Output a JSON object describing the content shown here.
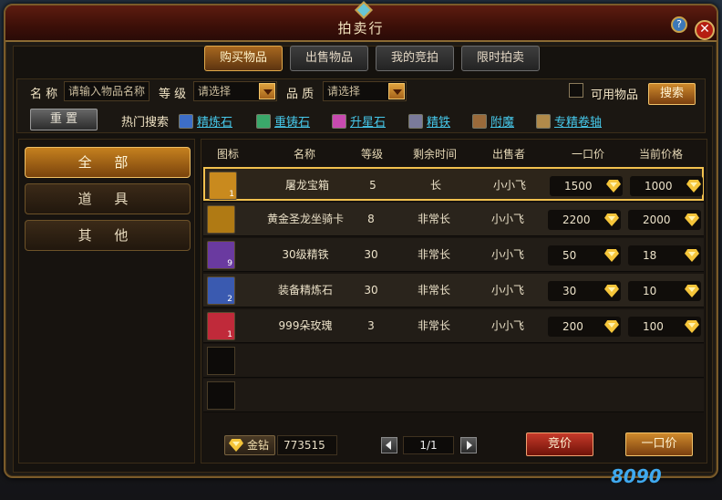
{
  "window": {
    "title": "拍卖行",
    "help_label": "?",
    "close_label": "✕"
  },
  "tabs": [
    {
      "label": "购买物品",
      "active": true
    },
    {
      "label": "出售物品",
      "active": false
    },
    {
      "label": "我的竞拍",
      "active": false
    },
    {
      "label": "限时拍卖",
      "active": false
    }
  ],
  "filters": {
    "name_label": "名 称",
    "name_placeholder": "请输入物品名称",
    "level_label": "等 级",
    "level_value": "请选择",
    "quality_label": "品 质",
    "quality_value": "请选择",
    "usable_label": "可用物品",
    "search_button": "搜索",
    "reset_button": "重 置",
    "hot_label": "热门搜索",
    "hot_items": [
      {
        "label": "精炼石",
        "color": "#3d6ec8"
      },
      {
        "label": "重铸石",
        "color": "#3aa86a"
      },
      {
        "label": "升星石",
        "color": "#c84ab0"
      },
      {
        "label": "精铁",
        "color": "#7a7a9a"
      },
      {
        "label": "附魔",
        "color": "#9a6a3a"
      },
      {
        "label": "专精卷轴",
        "color": "#b08a4a"
      }
    ]
  },
  "categories": [
    {
      "label": "全 部",
      "active": true
    },
    {
      "label": "道 具",
      "active": false
    },
    {
      "label": "其 他",
      "active": false
    }
  ],
  "table": {
    "headers": [
      "图标",
      "名称",
      "等级",
      "剩余时间",
      "出售者",
      "一口价",
      "当前价格"
    ],
    "rows": [
      {
        "icon": "treasure-chest-icon",
        "icon_color": "#c98a1e",
        "qty": "1",
        "name": "屠龙宝箱",
        "level": "5",
        "time": "长",
        "seller": "小小飞",
        "buyout": "1500",
        "current": "1000",
        "selected": true
      },
      {
        "icon": "golden-dragon-mount-card-icon",
        "icon_color": "#b07a14",
        "qty": "",
        "name": "黄金圣龙坐骑卡",
        "level": "8",
        "time": "非常长",
        "seller": "小小飞",
        "buyout": "2200",
        "current": "2000",
        "selected": false
      },
      {
        "icon": "refined-iron-icon",
        "icon_color": "#6a3aa0",
        "qty": "9",
        "name": "30级精铁",
        "level": "30",
        "time": "非常长",
        "seller": "小小飞",
        "buyout": "50",
        "current": "18",
        "selected": false
      },
      {
        "icon": "refining-stone-icon",
        "icon_color": "#3a5ab0",
        "qty": "2",
        "name": "装备精炼石",
        "level": "30",
        "time": "非常长",
        "seller": "小小飞",
        "buyout": "30",
        "current": "10",
        "selected": false
      },
      {
        "icon": "rose-bouquet-icon",
        "icon_color": "#c02a3a",
        "qty": "1",
        "name": "999朵玫瑰",
        "level": "3",
        "time": "非常长",
        "seller": "小小飞",
        "buyout": "200",
        "current": "100",
        "selected": false
      }
    ]
  },
  "footer": {
    "gold_label": "金钻",
    "gold_value": "773515",
    "page": "1/1",
    "bid_button": "竞价",
    "buyout_button": "一口价"
  },
  "watermark": "8090"
}
